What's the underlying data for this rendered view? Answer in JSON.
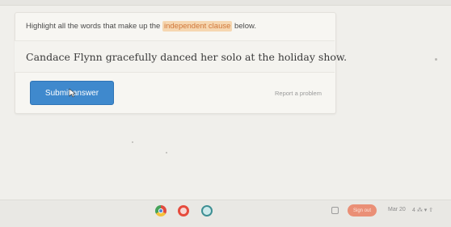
{
  "question": {
    "instruction_before": "Highlight all the words that make up the ",
    "instruction_highlight": "independent clause",
    "instruction_after": " below.",
    "sentence": "Candace Flynn gracefully danced her solo at the holiday show."
  },
  "actions": {
    "submit_label": "Submit answer",
    "report_label": "Report a problem"
  },
  "colors": {
    "accent": "#3f89cd",
    "highlight_bg": "#f6d7b1",
    "highlight_text": "#d0773a",
    "tray_pill": "#ea8f76"
  },
  "taskbar": {
    "pill_label": "Sign out",
    "tray_text": "Mar 20",
    "tray_status": "4 ⁂ ▾ ⇧",
    "icons": [
      "chrome-icon",
      "app-icon-red",
      "app-icon-teal",
      "screenshot-icon"
    ]
  }
}
